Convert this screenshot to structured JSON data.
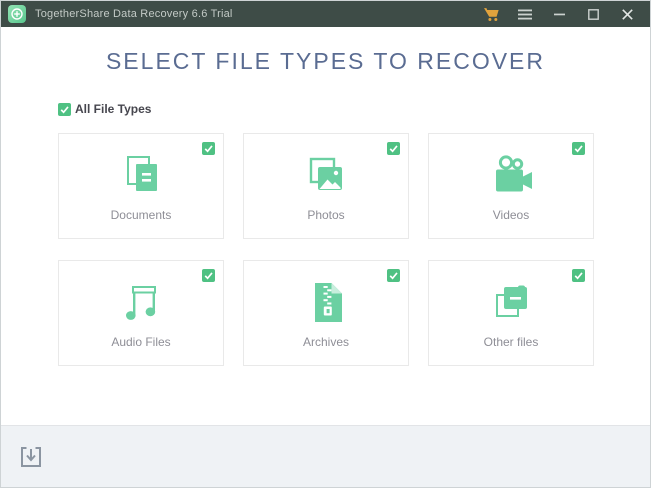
{
  "colors": {
    "titlebar_bg": "#3e4c47",
    "icon_green": "#6bd0a2",
    "checkbox_green": "#4fc183",
    "heading_blue": "#5a6c92",
    "cart_orange": "#e2a33d",
    "footer_bg": "#eff2f5"
  },
  "titlebar": {
    "title": "TogetherShare Data Recovery 6.6 Trial",
    "controls": [
      "cart",
      "menu",
      "minimize",
      "maximize",
      "close"
    ]
  },
  "main": {
    "heading": "SELECT FILE TYPES TO RECOVER",
    "all_file_types": {
      "label": "All File Types",
      "checked": true
    }
  },
  "cards": [
    {
      "label": "Documents",
      "icon": "documents-icon",
      "checked": true
    },
    {
      "label": "Photos",
      "icon": "photos-icon",
      "checked": true
    },
    {
      "label": "Videos",
      "icon": "videos-icon",
      "checked": true
    },
    {
      "label": "Audio Files",
      "icon": "audio-files-icon",
      "checked": true
    },
    {
      "label": "Archives",
      "icon": "archives-icon",
      "checked": true
    },
    {
      "label": "Other files",
      "icon": "other-files-icon",
      "checked": true
    }
  ],
  "footer": {
    "icons": [
      "download"
    ]
  }
}
